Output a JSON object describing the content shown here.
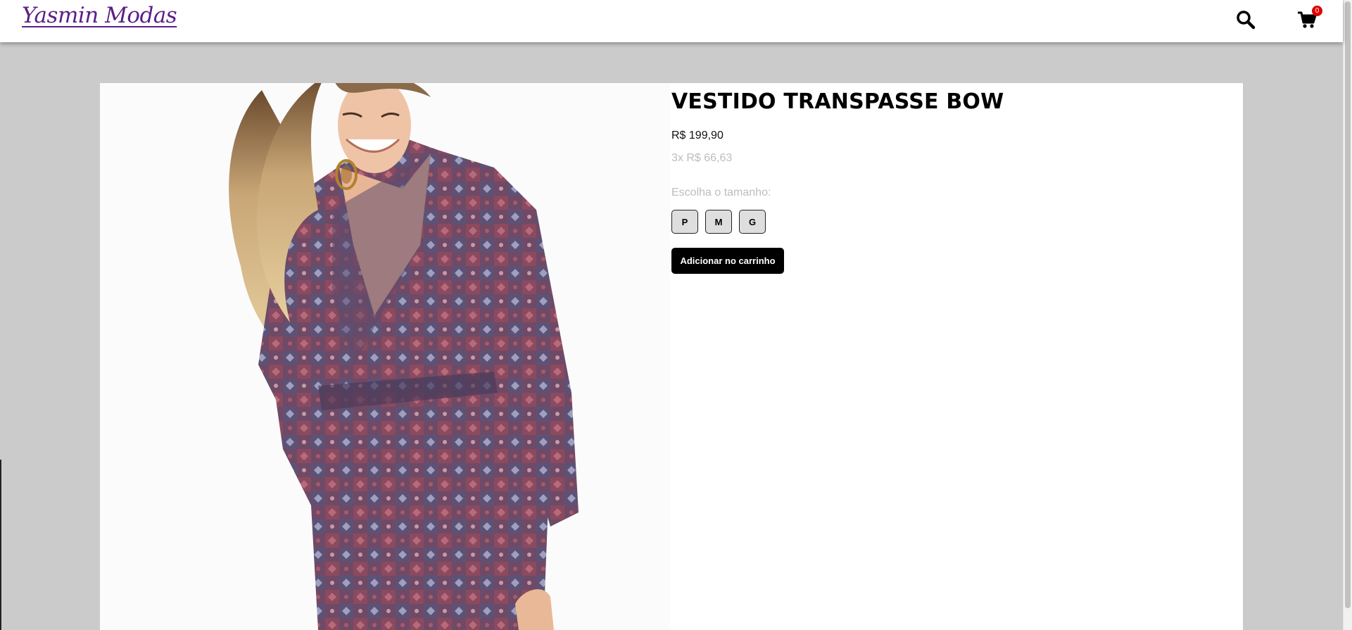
{
  "header": {
    "logo_text": "Yasmin Modas",
    "logo_color": "#5a1f86",
    "cart_count": "0",
    "icons": [
      "search-icon",
      "cart-icon"
    ]
  },
  "product": {
    "title": "VESTIDO TRANSPASSE BOW",
    "price": "R$ 199,90",
    "installments": "3x R$ 66,63",
    "size_prompt": "Escolha o tamanho:",
    "sizes": [
      "P",
      "M",
      "G"
    ],
    "add_to_cart_label": "Adicionar no carrinho",
    "image_subject": "model wearing long-sleeve patterned wrap dress"
  },
  "colors": {
    "page_background": "#cbcbcb",
    "accent": "#5a1f86",
    "badge": "#e00000",
    "button": "#000000"
  }
}
